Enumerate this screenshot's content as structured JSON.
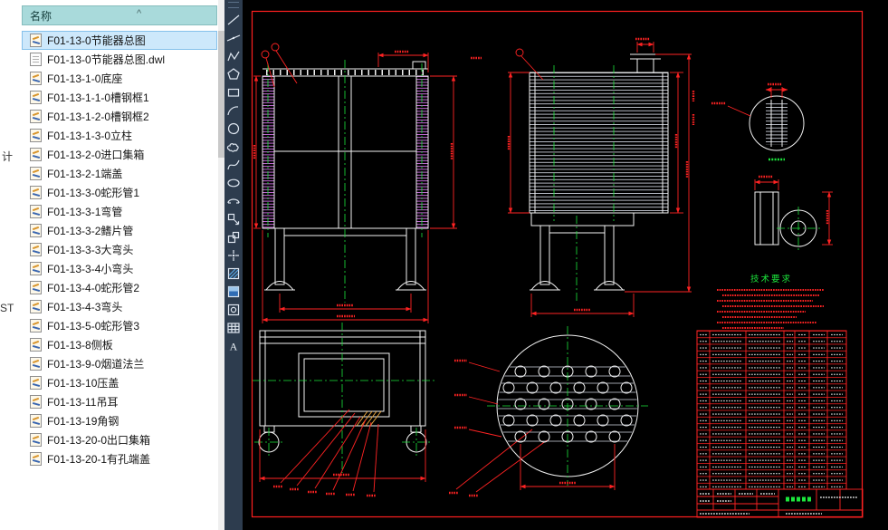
{
  "explorer": {
    "header": "名称",
    "sort_caret": "^",
    "tree_fragments": [
      "计",
      "ST"
    ],
    "items": [
      {
        "name": "F01-13-0节能器总图",
        "type": "dwg",
        "selected": true
      },
      {
        "name": "F01-13-0节能器总图.dwl",
        "type": "dwl",
        "selected": false
      },
      {
        "name": "F01-13-1-0底座",
        "type": "dwg",
        "selected": false
      },
      {
        "name": "F01-13-1-1-0槽钢框1",
        "type": "dwg",
        "selected": false
      },
      {
        "name": "F01-13-1-2-0槽钢框2",
        "type": "dwg",
        "selected": false
      },
      {
        "name": "F01-13-1-3-0立柱",
        "type": "dwg",
        "selected": false
      },
      {
        "name": "F01-13-2-0进口集箱",
        "type": "dwg",
        "selected": false
      },
      {
        "name": "F01-13-2-1端盖",
        "type": "dwg",
        "selected": false
      },
      {
        "name": "F01-13-3-0蛇形管1",
        "type": "dwg",
        "selected": false
      },
      {
        "name": "F01-13-3-1弯管",
        "type": "dwg",
        "selected": false
      },
      {
        "name": "F01-13-3-2鳍片管",
        "type": "dwg",
        "selected": false
      },
      {
        "name": "F01-13-3-3大弯头",
        "type": "dwg",
        "selected": false
      },
      {
        "name": "F01-13-3-4小弯头",
        "type": "dwg",
        "selected": false
      },
      {
        "name": "F01-13-4-0蛇形管2",
        "type": "dwg",
        "selected": false
      },
      {
        "name": "F01-13-4-3弯头",
        "type": "dwg",
        "selected": false
      },
      {
        "name": "F01-13-5-0蛇形管3",
        "type": "dwg",
        "selected": false
      },
      {
        "name": "F01-13-8侧板",
        "type": "dwg",
        "selected": false
      },
      {
        "name": "F01-13-9-0烟道法兰",
        "type": "dwg",
        "selected": false
      },
      {
        "name": "F01-13-10压盖",
        "type": "dwg",
        "selected": false
      },
      {
        "name": "F01-13-11吊耳",
        "type": "dwg",
        "selected": false
      },
      {
        "name": "F01-13-19角钢",
        "type": "dwg",
        "selected": false
      },
      {
        "name": "F01-13-20-0出口集箱",
        "type": "dwg",
        "selected": false
      },
      {
        "name": "F01-13-20-1有孔端盖",
        "type": "dwg",
        "selected": false
      }
    ]
  },
  "toolbar": {
    "tools": [
      "Line",
      "Construction Line",
      "Polyline",
      "Polygon",
      "Rectangle",
      "Arc",
      "Circle",
      "Revision Cloud",
      "Spline",
      "Ellipse",
      "Ellipse Arc",
      "Insert Block",
      "Make Block",
      "Point",
      "Hatch",
      "Gradient",
      "Region",
      "Table",
      "Multiline Text"
    ]
  },
  "canvas": {
    "notes_title": "技术要求",
    "colors": {
      "background": "#000000",
      "frame": "#ff1f1f",
      "geometry": "#f2f2f2",
      "dimension": "#ff2323",
      "centerline": "#1ce63c",
      "fins": "#d978f0",
      "weld": "#e8a43c"
    }
  }
}
